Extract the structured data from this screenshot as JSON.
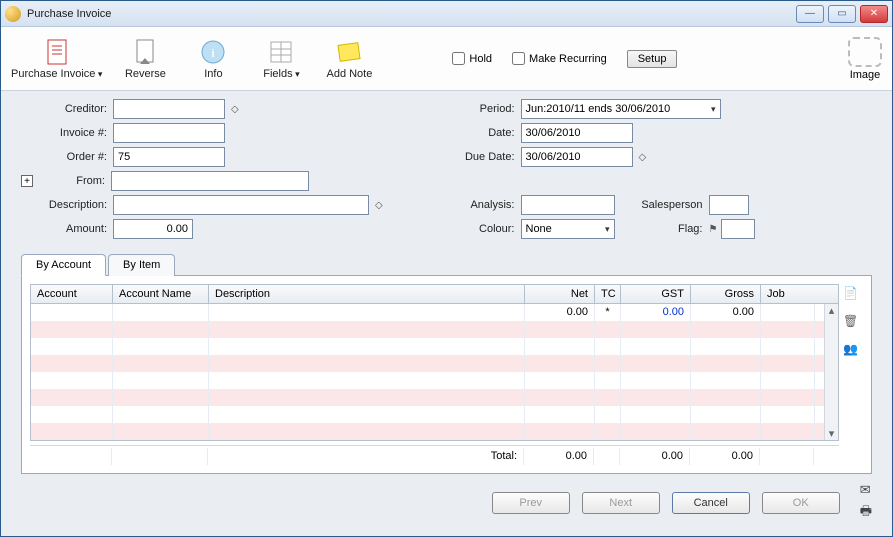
{
  "window": {
    "title": "Purchase Invoice"
  },
  "toolbar": {
    "purchase_invoice": "Purchase Invoice",
    "reverse": "Reverse",
    "info": "Info",
    "fields": "Fields",
    "add_note": "Add Note",
    "hold": "Hold",
    "make_recurring": "Make Recurring",
    "setup": "Setup",
    "image": "Image"
  },
  "form": {
    "creditor_label": "Creditor:",
    "creditor": "",
    "invoice_no_label": "Invoice #:",
    "invoice_no": "",
    "order_no_label": "Order #:",
    "order_no": "75",
    "from_label": "From:",
    "from": "",
    "description_label": "Description:",
    "description": "",
    "amount_label": "Amount:",
    "amount": "0.00",
    "period_label": "Period:",
    "period": "Jun:2010/11 ends 30/06/2010",
    "date_label": "Date:",
    "date": "30/06/2010",
    "due_date_label": "Due Date:",
    "due_date": "30/06/2010",
    "analysis_label": "Analysis:",
    "analysis": "",
    "salesperson_label": "Salesperson",
    "salesperson": "",
    "colour_label": "Colour:",
    "colour": "None",
    "flag_label": "Flag:",
    "flag": ""
  },
  "tabs": {
    "by_account": "By Account",
    "by_item": "By Item"
  },
  "grid": {
    "headers": {
      "account": "Account",
      "account_name": "Account Name",
      "description": "Description",
      "net": "Net",
      "tc": "TC",
      "gst": "GST",
      "gross": "Gross",
      "job": "Job"
    },
    "row0": {
      "net": "0.00",
      "tc": "*",
      "gst": "0.00",
      "gross": "0.00"
    },
    "total_label": "Total:",
    "totals": {
      "net": "0.00",
      "gst": "0.00",
      "gross": "0.00"
    }
  },
  "footer": {
    "prev": "Prev",
    "next": "Next",
    "cancel": "Cancel",
    "ok": "OK"
  }
}
